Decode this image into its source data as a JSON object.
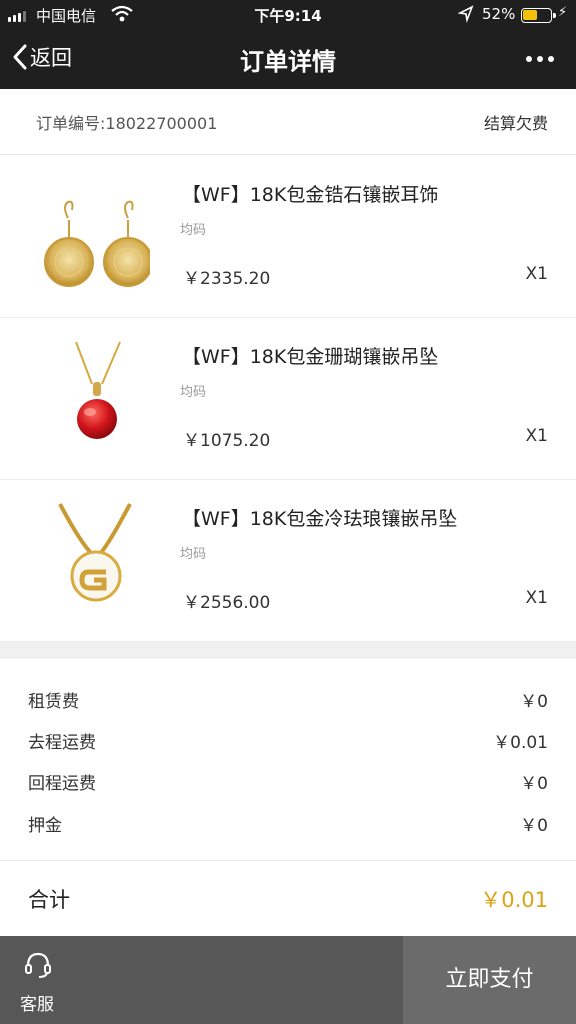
{
  "status_bar": {
    "carrier": "中国电信",
    "time": "下午9:14",
    "battery_percent": "52%",
    "battery_level": 0.52,
    "signal_bars": 3
  },
  "nav": {
    "back_label": "返回",
    "title": "订单详情"
  },
  "order": {
    "number_label": "订单编号:18022700001",
    "status": "结算欠费"
  },
  "items": [
    {
      "name": "【WF】18K包金锆石镶嵌耳饰",
      "size": "均码",
      "price": "￥2335.20",
      "qty": "X1",
      "image": "gold-earrings"
    },
    {
      "name": "【WF】18K包金珊瑚镶嵌吊坠",
      "size": "均码",
      "price": "￥1075.20",
      "qty": "X1",
      "image": "red-coral-pendant"
    },
    {
      "name": "【WF】18K包金冷珐琅镶嵌吊坠",
      "size": "均码",
      "price": "￥2556.00",
      "qty": "X1",
      "image": "enamel-g-pendant"
    }
  ],
  "fees": [
    {
      "label": "租赁费",
      "value": "￥0"
    },
    {
      "label": "去程运费",
      "value": "￥0.01"
    },
    {
      "label": "回程运费",
      "value": "￥0"
    },
    {
      "label": "押金",
      "value": "￥0"
    }
  ],
  "total": {
    "label": "合计",
    "value": "￥0.01",
    "color": "#dba316"
  },
  "bottom": {
    "service_label": "客服",
    "service_icon": "headset-icon",
    "pay_label": "立即支付"
  }
}
